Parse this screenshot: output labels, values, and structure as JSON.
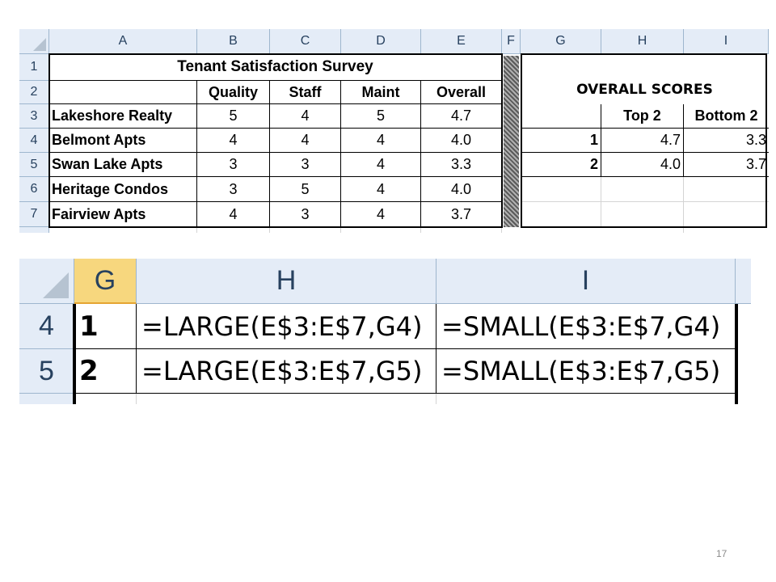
{
  "sheet1": {
    "columns": [
      "A",
      "B",
      "C",
      "D",
      "E",
      "F",
      "G",
      "H",
      "I"
    ],
    "rows": [
      "1",
      "2",
      "3",
      "4",
      "5",
      "6",
      "7"
    ],
    "title": "Tenant Satisfaction Survey",
    "headers": [
      "Quality",
      "Staff",
      "Maint",
      "Overall"
    ],
    "data": [
      [
        "Lakeshore Realty",
        "5",
        "4",
        "5",
        "4.7"
      ],
      [
        "Belmont Apts",
        "4",
        "4",
        "4",
        "4.0"
      ],
      [
        "Swan Lake Apts",
        "3",
        "3",
        "4",
        "3.3"
      ],
      [
        "Heritage Condos",
        "3",
        "5",
        "4",
        "4.0"
      ],
      [
        "Fairview Apts",
        "4",
        "3",
        "4",
        "3.7"
      ]
    ],
    "scores_title": "OVERALL SCORES",
    "scores_headers": [
      "Top 2",
      "Bottom 2"
    ],
    "scores": [
      [
        "1",
        "4.7",
        "3.3"
      ],
      [
        "2",
        "4.0",
        "3.7"
      ]
    ]
  },
  "sheet2": {
    "columns": [
      "G",
      "H",
      "I"
    ],
    "rows": [
      "4",
      "5"
    ],
    "formulas": [
      [
        "1",
        "=LARGE(E$3:E$7,G4)",
        "=SMALL(E$3:E$7,G4)"
      ],
      [
        "2",
        "=LARGE(E$3:E$7,G5)",
        "=SMALL(E$3:E$7,G5)"
      ]
    ]
  },
  "page_number": "17",
  "colors": {
    "header_bg": "#e4ecf7",
    "header_border": "#9eb6ce",
    "selected_header": "#f7d77e",
    "header_text": "#27415f"
  }
}
